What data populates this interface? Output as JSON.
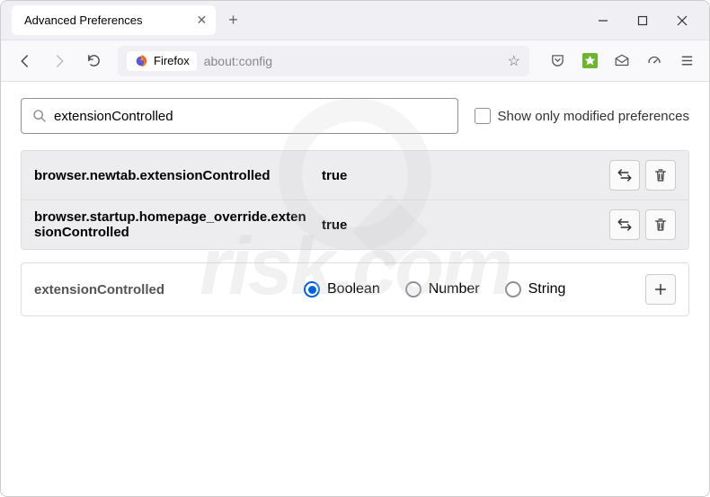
{
  "titlebar": {
    "tab_title": "Advanced Preferences"
  },
  "toolbar": {
    "urlbar_badge": "Firefox",
    "url": "about:config"
  },
  "search": {
    "value": "extensionControlled",
    "placeholder": "",
    "checkbox_label": "Show only modified preferences"
  },
  "prefs": [
    {
      "name": "browser.newtab.extensionControlled",
      "value": "true"
    },
    {
      "name": "browser.startup.homepage_override.extensionControlled",
      "value": "true"
    }
  ],
  "add": {
    "name": "extensionControlled",
    "types": [
      "Boolean",
      "Number",
      "String"
    ],
    "selected": "Boolean"
  }
}
